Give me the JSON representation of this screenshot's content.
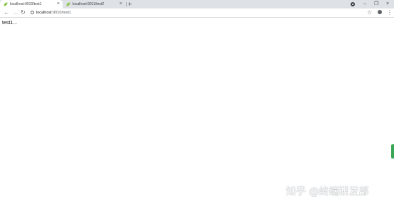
{
  "tabs": [
    {
      "title": "localhost:9010/test1",
      "active": true
    },
    {
      "title": "localhost:9011/test2",
      "active": false
    }
  ],
  "toolbar": {
    "url_host": "localhost",
    "url_path": ":9010/test1"
  },
  "page": {
    "text": "test1..."
  },
  "watermark": {
    "text": "知乎 @终端研发部"
  },
  "icons": {
    "back": "back-arrow-icon",
    "forward": "forward-arrow-icon",
    "reload": "reload-icon",
    "info": "info-icon",
    "star": "star-icon",
    "profile": "profile-icon",
    "menu": "kebab-menu-icon",
    "new_tab": "plus-icon",
    "extension": "record-icon"
  },
  "colors": {
    "tabstrip": "#dee1e6",
    "favicon": "#8bc34a",
    "accent": "#3aa757"
  }
}
